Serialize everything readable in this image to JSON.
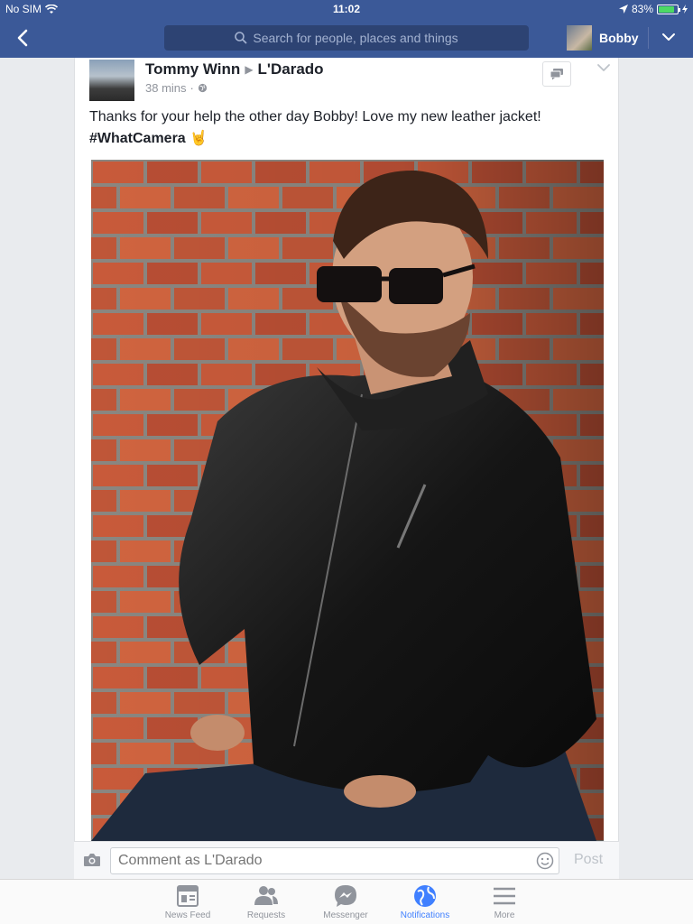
{
  "status_bar": {
    "carrier": "No SIM",
    "time": "11:02",
    "battery_percent": "83%",
    "battery_level": 0.83
  },
  "nav": {
    "search_placeholder": "Search for people, places and things",
    "user_name": "Bobby"
  },
  "post": {
    "author": "Tommy Winn",
    "target": "L'Darado",
    "time_ago": "38 mins",
    "meta_separator": "·",
    "text": "Thanks for your help the other day Bobby! Love my new leather jacket!",
    "hashtag": "#WhatCamera",
    "emoji": "🤘"
  },
  "comment": {
    "placeholder": "Comment as L'Darado",
    "post_label": "Post"
  },
  "tabs": [
    {
      "label": "News Feed",
      "icon": "news-feed-icon",
      "active": false
    },
    {
      "label": "Requests",
      "icon": "requests-icon",
      "active": false
    },
    {
      "label": "Messenger",
      "icon": "messenger-icon",
      "active": false
    },
    {
      "label": "Notifications",
      "icon": "globe-icon",
      "active": true
    },
    {
      "label": "More",
      "icon": "menu-icon",
      "active": false
    }
  ],
  "colors": {
    "brand": "#3b5998",
    "active_tab": "#4080ff",
    "battery": "#4cd964"
  }
}
